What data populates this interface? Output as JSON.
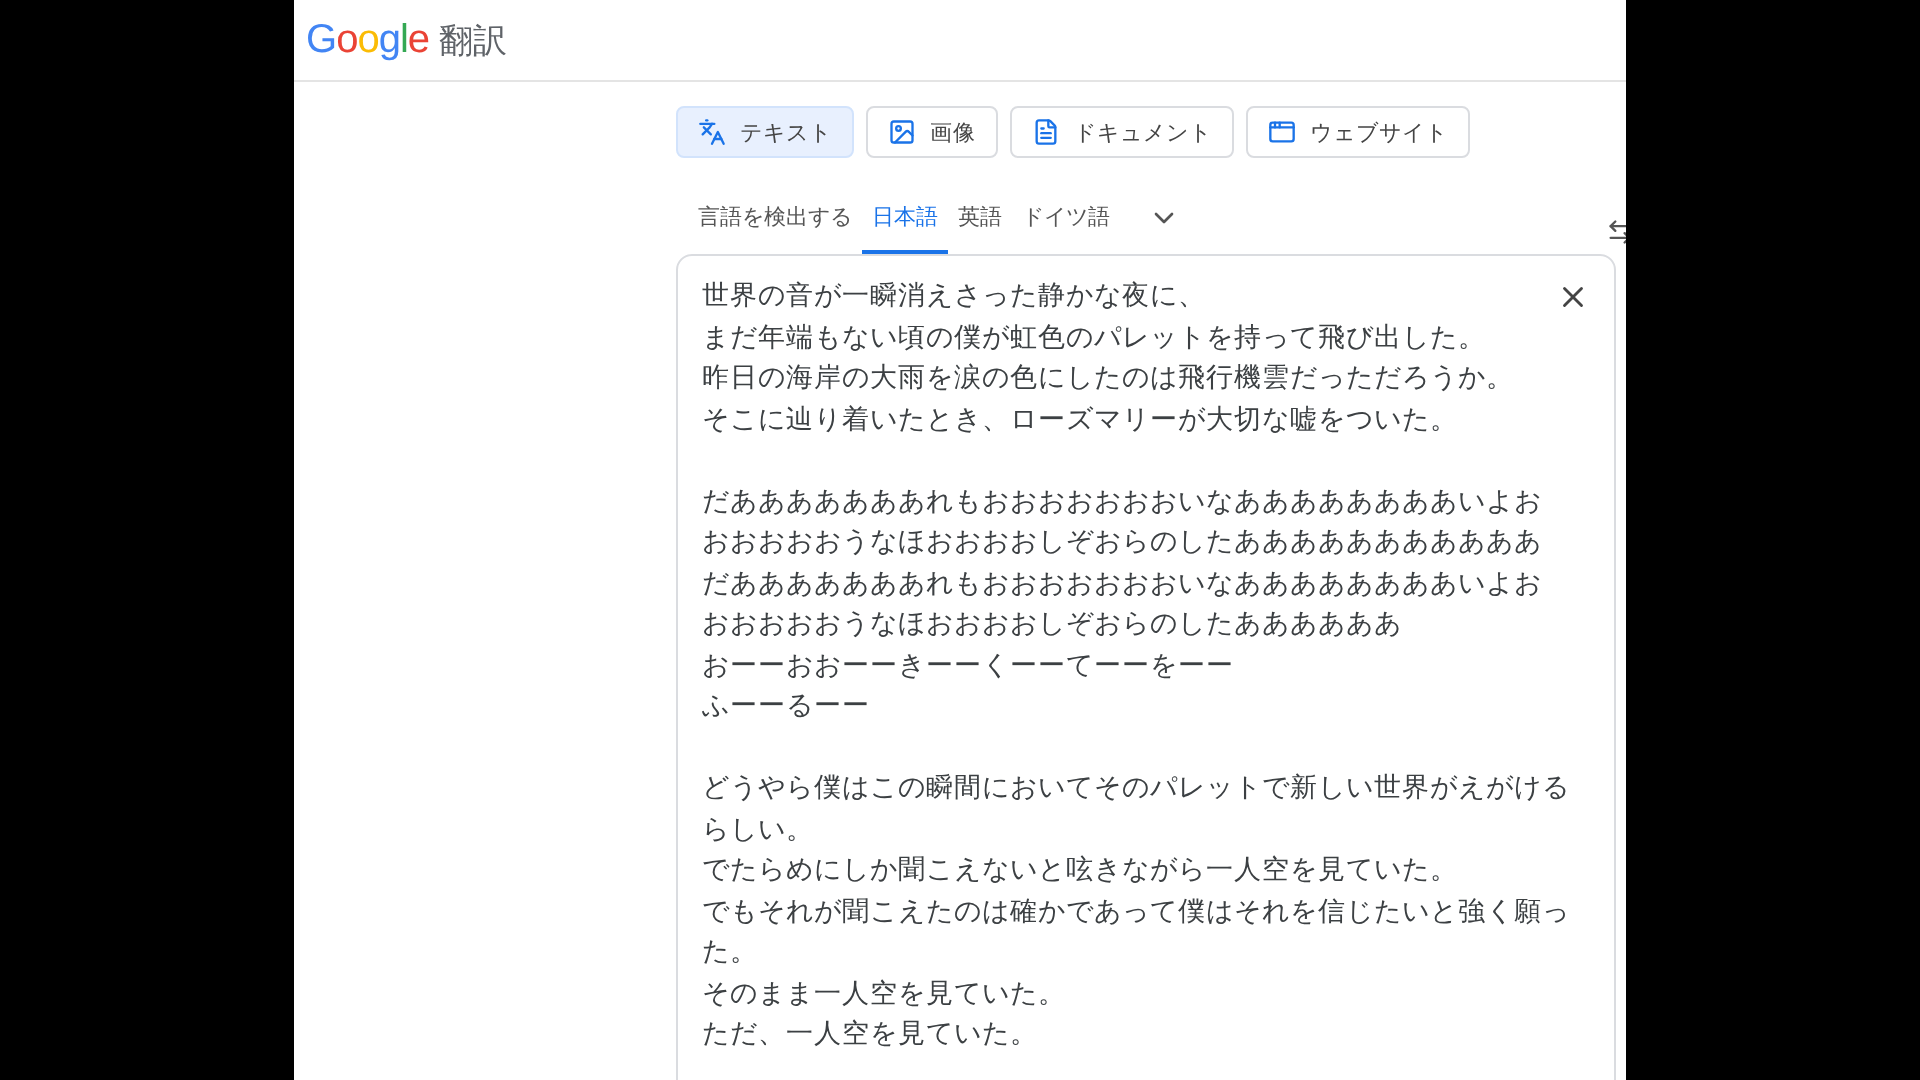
{
  "header": {
    "logo": "Google",
    "product": "翻訳"
  },
  "modes": [
    {
      "label": "テキスト",
      "kind": "text",
      "selected": true
    },
    {
      "label": "画像",
      "kind": "image",
      "selected": false
    },
    {
      "label": "ドキュメント",
      "kind": "document",
      "selected": false
    },
    {
      "label": "ウェブサイト",
      "kind": "website",
      "selected": false
    }
  ],
  "source_languages": [
    {
      "label": "言語を検出する",
      "selected": false
    },
    {
      "label": "日本語",
      "selected": true
    },
    {
      "label": "英語",
      "selected": false
    },
    {
      "label": "ドイツ語",
      "selected": false
    }
  ],
  "input": {
    "paragraphs": [
      [
        "世界の音が一瞬消えさった静かな夜に、",
        "まだ年端もない頃の僕が虹色のパレットを持って飛び出した。",
        "昨日の海岸の大雨を涙の色にしたのは飛行機雲だっただろうか。",
        "そこに辿り着いたとき、ローズマリーが大切な嘘をついた。"
      ],
      [
        "だあああああああれもおおおおおおおいなああああああああいよお",
        "おおおおおうなほおおおおしぞおらのしたあああああああああああ",
        "だあああああああれもおおおおおおおいなああああああああいよお",
        "おおおおおうなほおおおおしぞおらのしたああああああ",
        "おーーおおーーきーーくーーてーーをーー",
        "ふーーるーー"
      ],
      [
        "どうやら僕はこの瞬間においてそのパレットで新しい世界がえがける",
        "らしい。",
        "でたらめにしか聞こえないと呟きながら一人空を見ていた。",
        "でもそれが聞こえたのは確かであって僕はそれを信じたいと強く願っ",
        "た。",
        "そのまま一人空を見ていた。",
        "ただ、一人空を見ていた。"
      ]
    ]
  }
}
